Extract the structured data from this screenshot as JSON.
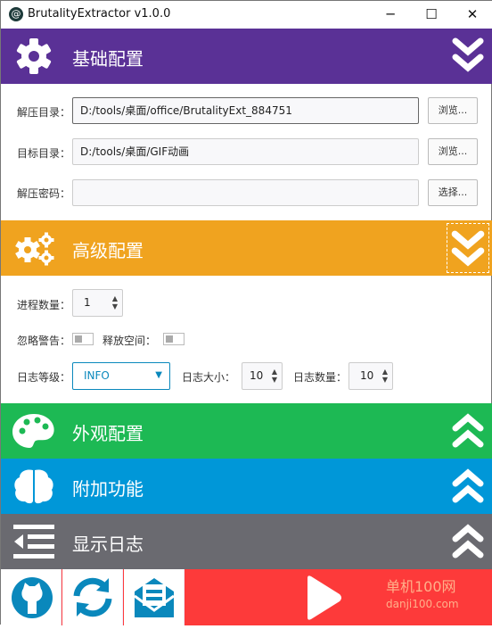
{
  "window": {
    "title": "BrutalityExtractor v1.0.0",
    "minimize": "─",
    "maximize": "☐",
    "close": "✕"
  },
  "colors": {
    "basic": "#5a3196",
    "advanced": "#f0a31f",
    "appearance": "#1db954",
    "extra": "#0097d8",
    "log": "#6a6a70",
    "start": "#fd3a3a",
    "icon": "#0a88bc"
  },
  "sections": {
    "basic": {
      "title": "基础配置",
      "icon": "gear-icon",
      "state": "expanded"
    },
    "advanced": {
      "title": "高级配置",
      "icon": "gears-icon",
      "state": "expanded"
    },
    "appearance": {
      "title": "外观配置",
      "icon": "palette-icon",
      "state": "collapsed"
    },
    "extra": {
      "title": "附加功能",
      "icon": "brain-icon",
      "state": "collapsed"
    },
    "log": {
      "title": "显示日志",
      "icon": "indent-icon",
      "state": "collapsed"
    }
  },
  "basic": {
    "extract_dir": {
      "label": "解压目录：",
      "value": "D:/tools/桌面/office/BrutalityExt_884751",
      "button": "浏览..."
    },
    "target_dir": {
      "label": "目标目录：",
      "value": "D:/tools/桌面/GIF动画",
      "button": "浏览..."
    },
    "password": {
      "label": "解压密码：",
      "value": "",
      "button": "选择..."
    }
  },
  "advanced": {
    "processes": {
      "label": "进程数量：",
      "value": "1"
    },
    "ignore_warnings": {
      "label": "忽略警告：",
      "on": false
    },
    "free_space": {
      "label": "释放空间：",
      "on": false
    },
    "log_level": {
      "label": "日志等级：",
      "value": "INFO"
    },
    "log_size": {
      "label": "日志大小：",
      "value": "10"
    },
    "log_count": {
      "label": "日志数量：",
      "value": "10"
    }
  },
  "bottom": {
    "github": "github-icon",
    "refresh": "refresh-icon",
    "mail": "mail-icon",
    "start": "play-icon"
  },
  "watermark": {
    "text": "单机100网",
    "url": "danji100.com"
  }
}
